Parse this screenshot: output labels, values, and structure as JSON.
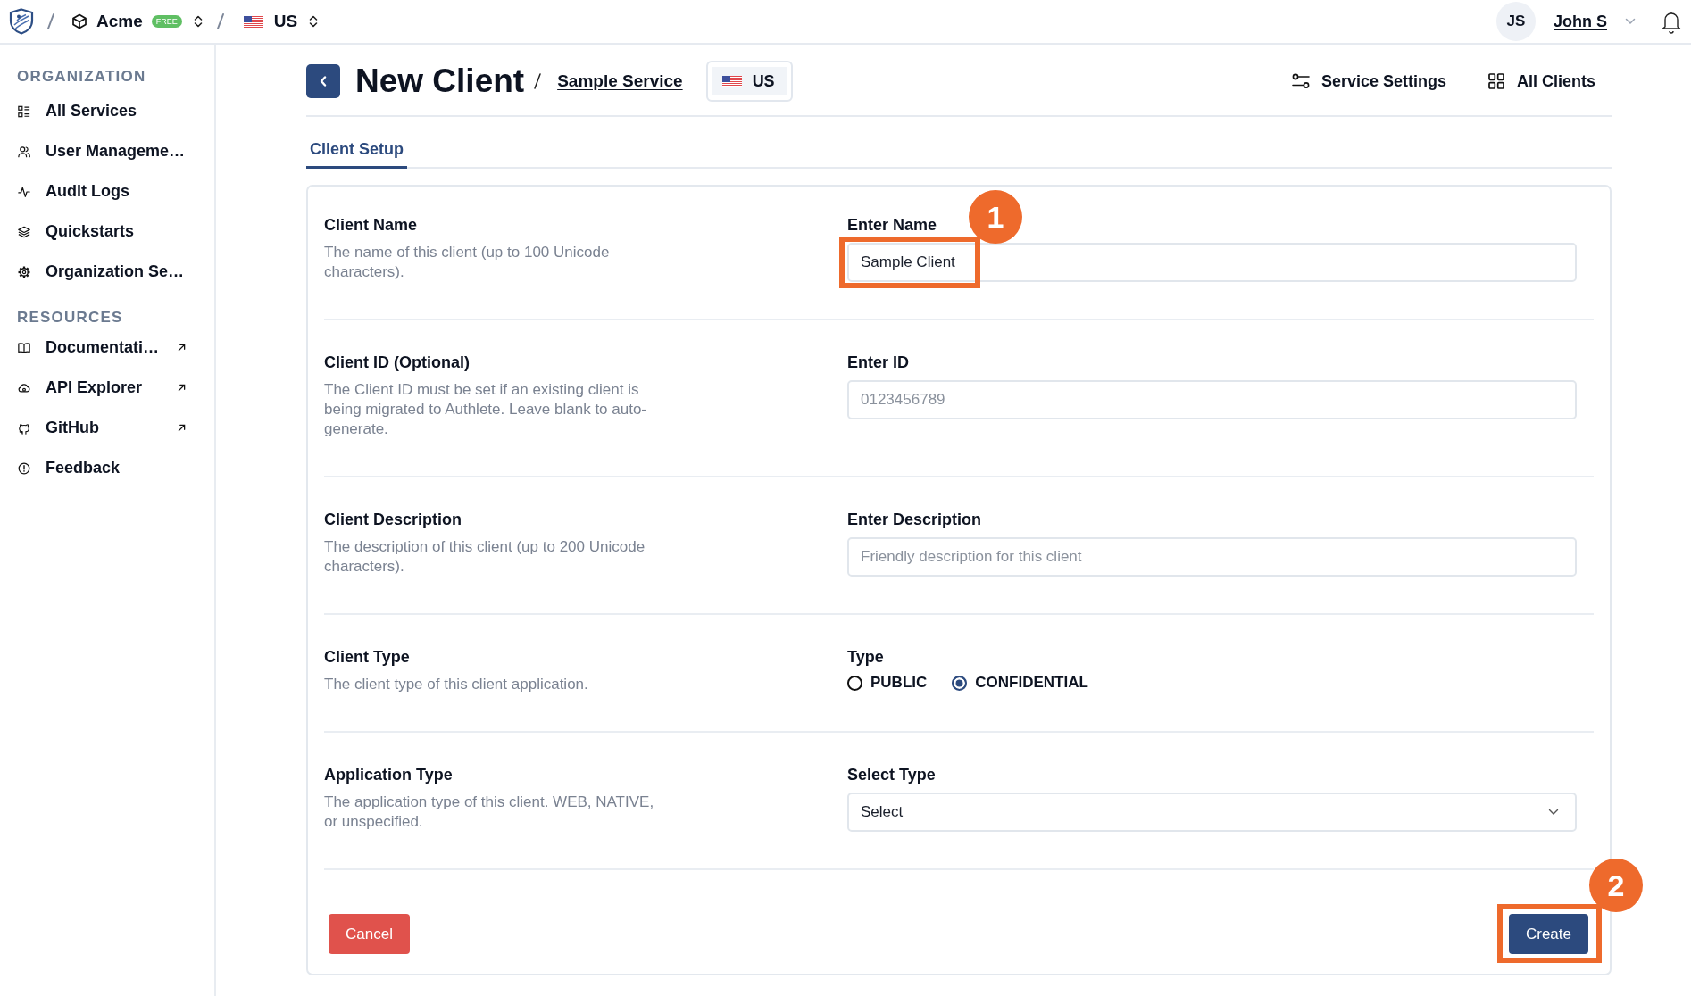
{
  "top_bar": {
    "breadcrumbs": [
      {
        "kind": "organization",
        "label": "Acme",
        "badge": "FREE"
      },
      {
        "kind": "region",
        "label": "US"
      }
    ],
    "user": {
      "initials": "JS",
      "name": "John S"
    }
  },
  "sidebar": {
    "sections": [
      {
        "heading": "ORGANIZATION",
        "items": [
          {
            "label": "All Services",
            "external": false
          },
          {
            "label": "User Manageme…",
            "external": false
          },
          {
            "label": "Audit Logs",
            "external": false
          },
          {
            "label": "Quickstarts",
            "external": false
          },
          {
            "label": "Organization Se…",
            "external": false
          }
        ]
      },
      {
        "heading": "RESOURCES",
        "items": [
          {
            "label": "Documentati…",
            "external": true
          },
          {
            "label": "API Explorer",
            "external": true
          },
          {
            "label": "GitHub",
            "external": true
          },
          {
            "label": "Feedback",
            "external": false
          }
        ]
      }
    ]
  },
  "page_header": {
    "title": "New Client",
    "breadcrumb": "Sample Service",
    "region": "US",
    "actions": [
      {
        "label": "Service Settings"
      },
      {
        "label": "All Clients"
      }
    ]
  },
  "tabs": [
    {
      "label": "Client Setup",
      "selected": true
    }
  ],
  "form": {
    "rows": [
      {
        "kind": "text",
        "title": "Client Name",
        "description": "The name of this client (up to 100 Unicode characters).",
        "field_label": "Enter Name",
        "value": "Sample Client",
        "callout": "1"
      },
      {
        "kind": "text",
        "title": "Client ID (Optional)",
        "description": "The Client ID must be set if an existing client is being migrated to Authlete. Leave blank to auto-generate.",
        "field_label": "Enter ID",
        "placeholder": "0123456789"
      },
      {
        "kind": "text",
        "title": "Client Description",
        "description": "The description of this client (up to 200 Unicode characters).",
        "field_label": "Enter Description",
        "placeholder": "Friendly description for this client"
      },
      {
        "kind": "radio",
        "title": "Client Type",
        "description": "The client type of this client application.",
        "field_label": "Type",
        "options": [
          {
            "label": "PUBLIC",
            "selected": false
          },
          {
            "label": "CONFIDENTIAL",
            "selected": true
          }
        ]
      },
      {
        "kind": "select",
        "title": "Application Type",
        "description": "The application type of this client. WEB, NATIVE, or unspecified.",
        "field_label": "Select Type",
        "value": "Select"
      }
    ],
    "buttons": [
      {
        "kind": "cancel",
        "label": "Cancel"
      },
      {
        "kind": "create",
        "label": "Create",
        "callout": "2"
      }
    ]
  }
}
